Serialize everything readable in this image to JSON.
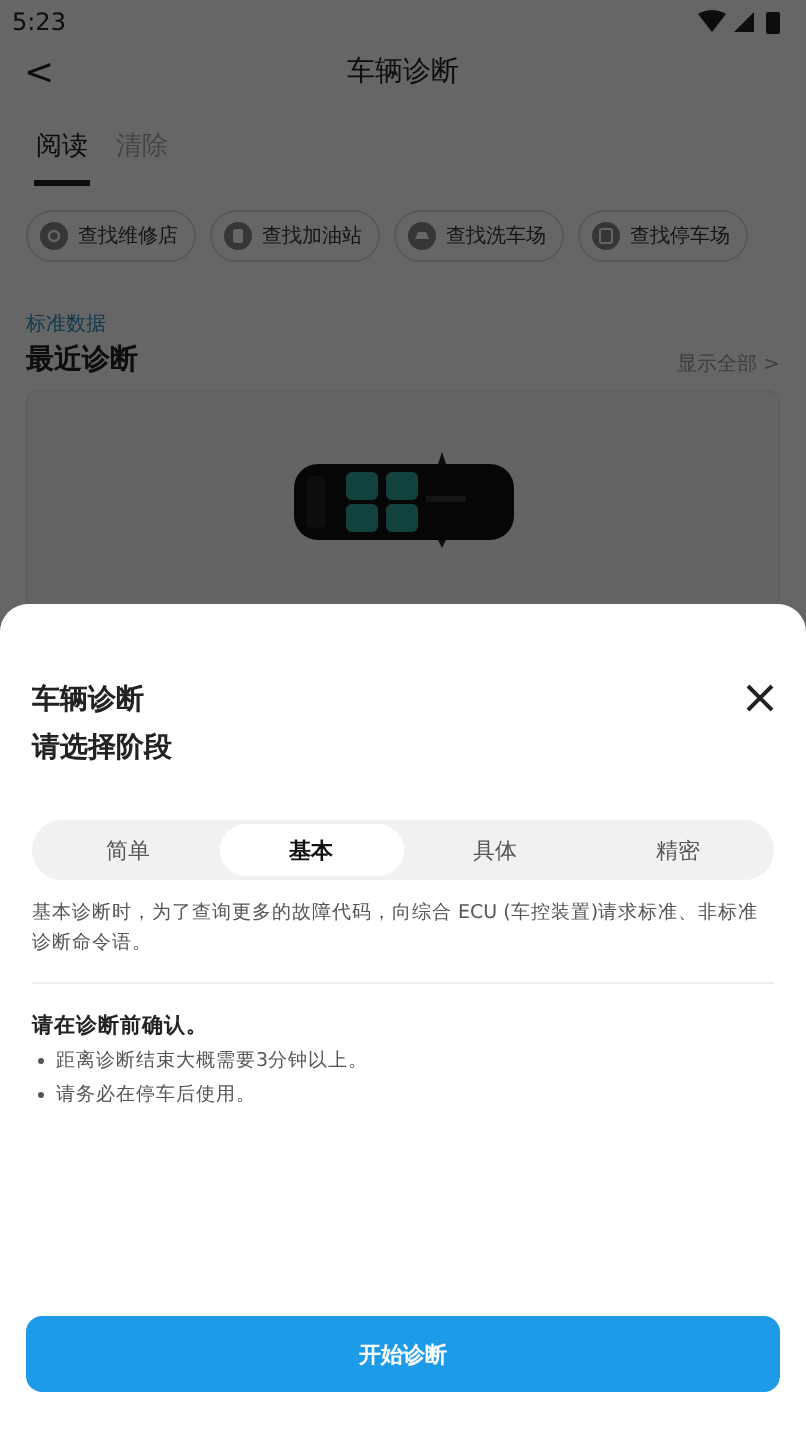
{
  "status_bar": {
    "time": "5:23"
  },
  "header": {
    "back": "<",
    "title": "车辆诊断"
  },
  "tabs": [
    {
      "label": "阅读",
      "selected": true
    },
    {
      "label": "清除",
      "selected": false
    }
  ],
  "chips": [
    {
      "kind": "repair",
      "label": "查找维修店"
    },
    {
      "kind": "fuel",
      "label": "查找加油站"
    },
    {
      "kind": "wash",
      "label": "查找洗车场"
    },
    {
      "kind": "parking",
      "label": "查找停车场"
    }
  ],
  "section": {
    "caption": "标准数据",
    "title": "最近诊断",
    "more": "显示全部 >"
  },
  "sheet": {
    "title": "车辆诊断",
    "subtitle": "请选择阶段",
    "stages": [
      {
        "label": "简单",
        "selected": false
      },
      {
        "label": "基本",
        "selected": true
      },
      {
        "label": "具体",
        "selected": false
      },
      {
        "label": "精密",
        "selected": false
      }
    ],
    "description": "基本诊断时，为了查询更多的故障代码，向综合 ECU (车控装置)请求标准、非标准诊断命令语。",
    "confirm_title": "请在诊断前确认。",
    "notes": [
      "距离诊断结束大概需要3分钟以上。",
      "请务必在停车后使用。"
    ],
    "start_button": "开始诊断"
  }
}
